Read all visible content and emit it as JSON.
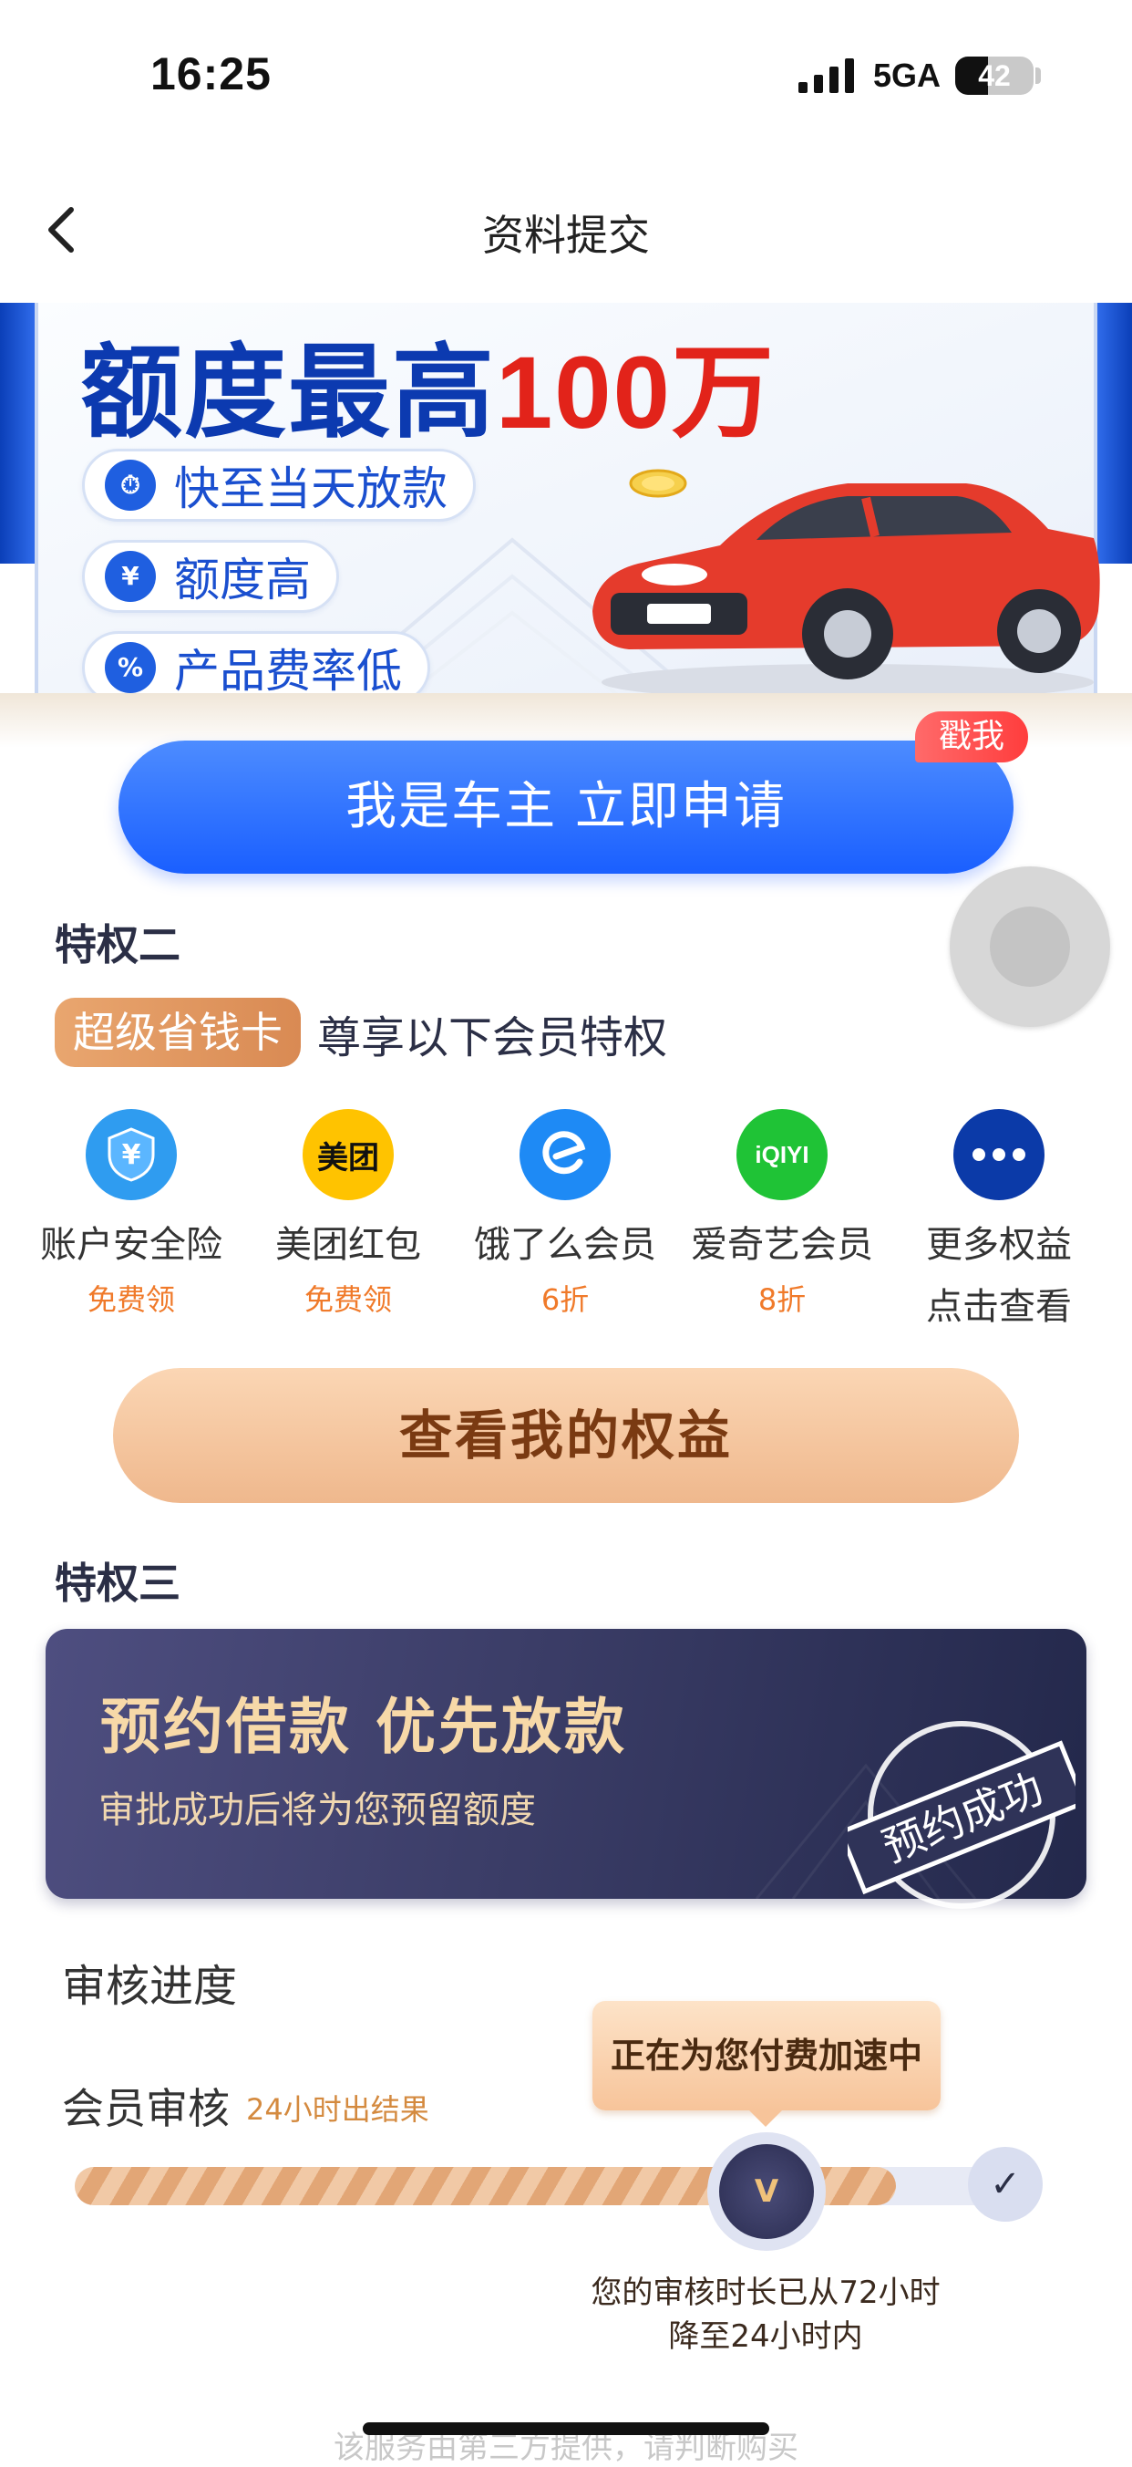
{
  "status_bar": {
    "time": "16:25",
    "network": "5GA",
    "battery": "42",
    "battery_level": 0.42
  },
  "nav": {
    "title": "资料提交",
    "back_icon": "chevron-left-icon"
  },
  "banner": {
    "headline_part1": "额度最高",
    "headline_part2": "100万",
    "features": [
      {
        "label": "快至当天放款",
        "icon": "clock-lightning-icon"
      },
      {
        "label": "额度高",
        "icon": "yuan-up-icon"
      },
      {
        "label": "产品费率低",
        "icon": "percent-down-icon"
      }
    ],
    "apply_button": "我是车主 立即申请",
    "poke_tag": "戳我"
  },
  "privilege2": {
    "title": "特权二",
    "tag": "超级省钱卡",
    "desc": "尊享以下会员特权",
    "benefits": [
      {
        "name": "账户安全险",
        "sub": "免费领",
        "icon": "shield-yuan-icon",
        "color": "#2f9cf0"
      },
      {
        "name": "美团红包",
        "sub": "免费领",
        "icon": "meituan-icon",
        "color": "#ffc300",
        "glyph": "美团"
      },
      {
        "name": "饿了么会员",
        "sub": "6折",
        "icon": "eleme-icon",
        "color": "#1e8af5"
      },
      {
        "name": "爱奇艺会员",
        "sub": "8折",
        "icon": "iqiyi-icon",
        "color": "#1fc336",
        "glyph": "iQIYI"
      },
      {
        "name": "更多权益",
        "sub": "点击查看",
        "icon": "more-dots-icon",
        "color": "#0b3aa8"
      }
    ],
    "rights_button": "查看我的权益"
  },
  "privilege3": {
    "title": "特权三",
    "card_title": "预约借款  优先放款",
    "card_sub": "审批成功后将为您预留额度",
    "stamp": "预约成功"
  },
  "progress": {
    "title": "审核进度",
    "member_review": "会员审核",
    "member_note": "24小时出结果",
    "bubble": "正在为您付费加速中",
    "progress_level": 0.85,
    "medal_letter": "V",
    "check": "✓",
    "time_note_line1": "您的审核时长已从72小时",
    "time_note_line2": "降至24小时内"
  },
  "footer": {
    "text": "该服务由第三方提供，请判断购买"
  },
  "colors": {
    "primary": "#1a5fff",
    "accent_orange": "#f07a2a",
    "navy": "#2b2f46"
  }
}
